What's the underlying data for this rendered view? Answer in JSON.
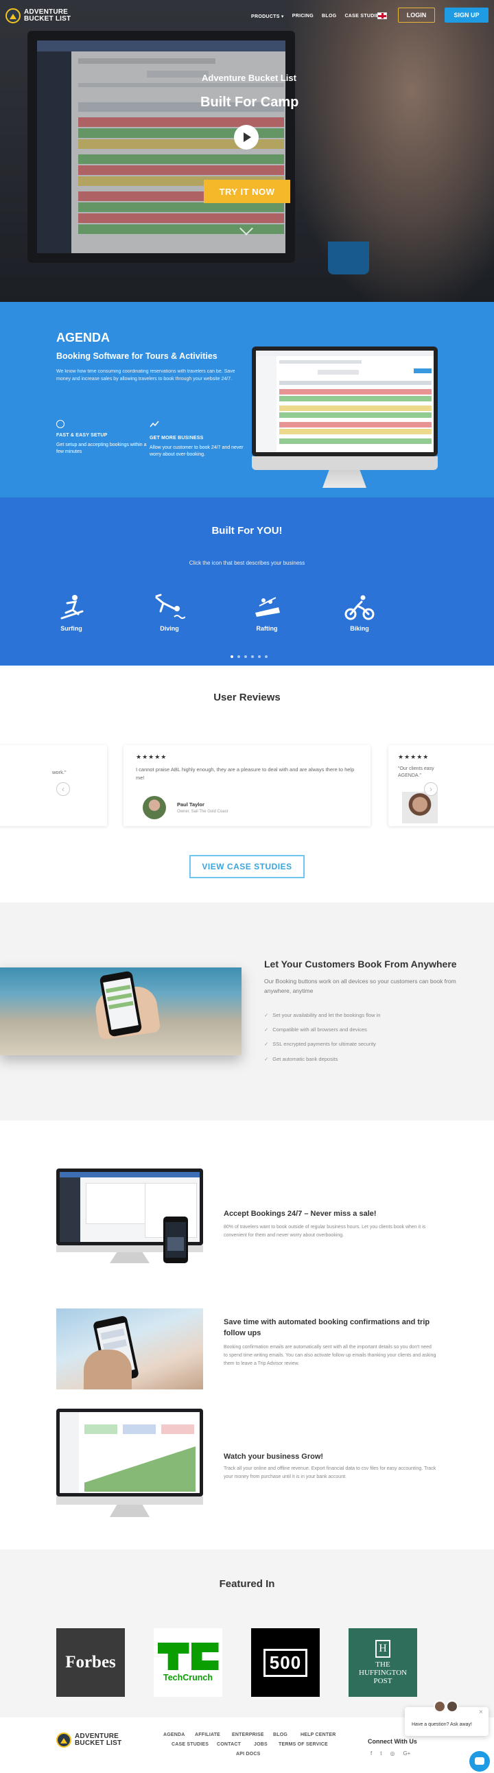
{
  "header": {
    "logo_line1": "ADVENTURE",
    "logo_line2": "BUCKET LIST",
    "nav": [
      "PRODUCTS ▾",
      "PRICING",
      "BLOG",
      "CASE STUDIES"
    ],
    "login": "LOGIN",
    "signup": "SIGN UP"
  },
  "hero": {
    "title": "Adventure Bucket List",
    "subtitle": "Built For Camp",
    "cta": "TRY IT NOW"
  },
  "agenda": {
    "heading": "AGENDA",
    "subheading": "Booking Software for Tours & Activities",
    "description": "We know how time consuming coordinating reservations with travelers can be. Save money and increase sales by allowing travelers to book through your website 24/7.",
    "features": [
      {
        "title": "FAST & EASY SETUP",
        "text": "Get setup and accepting bookings within a few minutes"
      },
      {
        "title": "GET MORE BUSINESS",
        "text": "Allow your customer to book 24/7 and never worry about over-booking."
      }
    ]
  },
  "built": {
    "heading": "Built For YOU!",
    "subtitle": "Click the icon that best describes your business",
    "activities": [
      "Surfing",
      "Diving",
      "Rafting",
      "Biking"
    ]
  },
  "reviews": {
    "heading": "User Reviews",
    "left_fragment": "work.\"",
    "stars": "★★★★★",
    "main_text": "I cannot praise ABL highly enough, they are a pleasure to deal with and are always there to help me!",
    "main_name": "Paul Taylor",
    "main_role": "Owner, Sail The Gold Coast",
    "right_fragment": "\"Our clients easy AGENDA.\"",
    "cta": "VIEW CASE STUDIES"
  },
  "anywhere": {
    "heading": "Let Your Customers Book From Anywhere",
    "description": "Our Booking buttons work on all devices so your customers can book from anywhere, anytime",
    "checks": [
      "Set your availability and let the bookings flow in",
      "Compatible with all browsers and devices",
      "SSL encrypted payments for ultimate security",
      "Get automatic bank deposits"
    ]
  },
  "features": [
    {
      "title": "Accept Bookings 24/7 – Never miss a sale!",
      "text": "80% of travelers want to book outside of regular business hours. Let you clients book when it is convenient for them and never worry about overbooking."
    },
    {
      "title": "Save time with automated booking confirmations and trip follow ups",
      "text": "Booking confirmation emails are automatically sent with all the important details so you don't need to spend time writing emails. You can also activate follow up emails thanking your clients and asking them to leave a Trip Advisor review."
    },
    {
      "title": "Watch your business Grow!",
      "text": "Track all your online and offline revenue. Export financial data to csv files for easy accounting. Track your money from purchase until it is in your bank account."
    }
  ],
  "featured": {
    "heading": "Featured In",
    "logos": [
      "Forbes",
      "TechCrunch",
      "500",
      "THE HUFFINGTON POST"
    ]
  },
  "footer": {
    "links_row1": [
      "AGENDA",
      "AFFILIATE",
      "ENTERPRISE",
      "BLOG",
      "HELP CENTER"
    ],
    "links_row2": [
      "CASE STUDIES",
      "CONTACT",
      "JOBS",
      "TERMS OF SERVICE"
    ],
    "links_row3": [
      "API DOCS"
    ],
    "connect": "Connect With Us",
    "social": [
      "f",
      "t",
      "◎",
      "G+"
    ]
  },
  "chat": {
    "text": "Have a question? Ask away!",
    "close": "×"
  },
  "colors": {
    "accent": "#2f8ee0",
    "cta": "#f4b82a",
    "signup": "#1e9be2"
  }
}
